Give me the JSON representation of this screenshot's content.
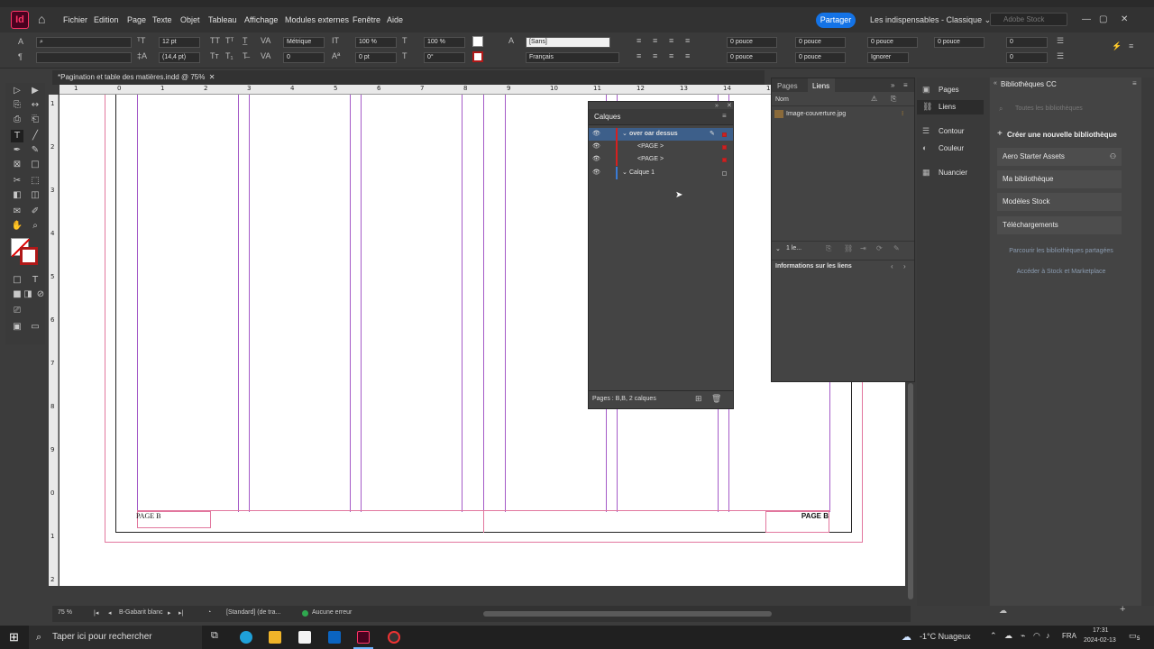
{
  "menubar": {
    "logo": "Id",
    "items": [
      "Fichier",
      "Edition",
      "Page",
      "Texte",
      "Objet",
      "Tableau",
      "Affichage",
      "Modules externes",
      "Fenêtre",
      "Aide"
    ],
    "share_label": "Partager",
    "workspace_label": "Les indispensables - Classique",
    "stock_placeholder": "Adobe Stock"
  },
  "control": {
    "font_size": "12 pt",
    "leading": "(14,4 pt)",
    "kerning": "Métrique",
    "tracking": "0",
    "h_scale": "100 %",
    "v_scale": "100 %",
    "baseline": "0 pt",
    "skew": "0°",
    "char_style": "[Sans]",
    "language": "Français",
    "indent1": "0 pouce",
    "indent2": "0 pouce",
    "indent3": "0 pouce",
    "indent4": "0 pouce",
    "indent5": "0 pouce",
    "indent6": "0 pouce",
    "indent7": "0 pouce",
    "indent8": "0 pouce",
    "grid_align": "Ignorer",
    "count1": "0",
    "count2": "0"
  },
  "document": {
    "tab_title": "*Pagination et table des matières.indd @ 75%",
    "ruler_top": [
      "1",
      "0",
      "1",
      "2",
      "3",
      "4",
      "5",
      "6",
      "7",
      "8",
      "9",
      "10",
      "11",
      "12",
      "13",
      "14",
      "15"
    ],
    "ruler_left": [
      "1",
      "2",
      "3",
      "4",
      "5",
      "6",
      "7",
      "8",
      "9",
      "0",
      "1",
      "2"
    ],
    "page_label_left": "PAGE B",
    "page_label_right": "PAGE B"
  },
  "statusbar": {
    "zoom": "75 %",
    "page": "B-Gabarit blanc",
    "style": "[Standard] (de tra...",
    "preflight": "Aucune erreur"
  },
  "calques": {
    "title": "Calques",
    "layers": [
      {
        "name": "over oar dessus",
        "selected": true
      },
      {
        "name": "<PAGE >",
        "selected": false
      },
      {
        "name": "<PAGE >",
        "selected": false
      },
      {
        "name": "Calque 1",
        "selected": false
      }
    ],
    "footer": "Pages : B,B, 2 calques"
  },
  "liens": {
    "tab_pages": "Pages",
    "tab_liens": "Liens",
    "col_name": "Nom",
    "link_file": "Image-couverture.jpg",
    "count": "1 le...",
    "info_label": "Informations sur les liens"
  },
  "sidecol": {
    "items": [
      "Pages",
      "Liens",
      "Contour",
      "Couleur",
      "Nuancier"
    ]
  },
  "libraries": {
    "title": "Bibliothèques CC",
    "search_placeholder": "Toutes les bibliothèques",
    "create_label": "Créer une nouvelle bibliothèque",
    "items": [
      "Aero Starter Assets",
      "Ma bibliothèque",
      "Modèles Stock",
      "Téléchargements"
    ],
    "link1": "Parcourir les bibliothèques partagées",
    "link2": "Accéder à Stock et Marketplace"
  },
  "taskbar": {
    "search_placeholder": "Taper ici pour rechercher",
    "weather": "-1°C  Nuageux",
    "lang": "FRA",
    "time": "17:31",
    "date": "2024-02-13",
    "notif": "5"
  }
}
